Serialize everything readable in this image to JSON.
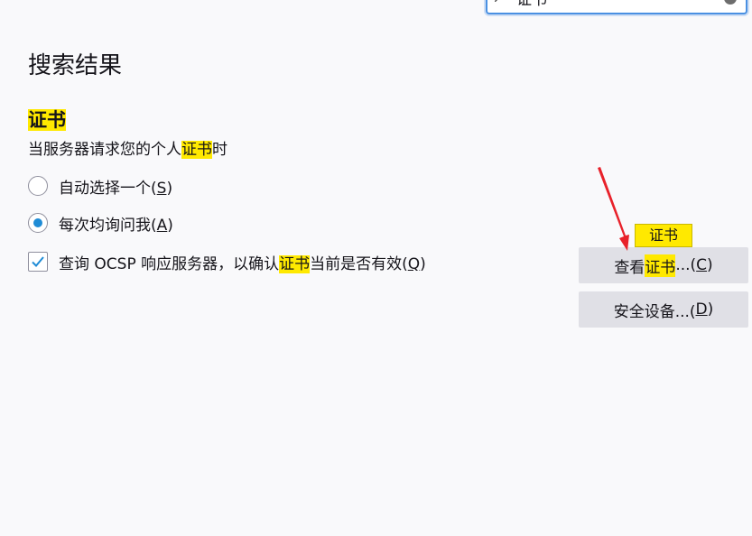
{
  "search": {
    "query": "证书"
  },
  "page": {
    "title": "搜索结果"
  },
  "certificates": {
    "section_title": "证书",
    "description_before": "当服务器请求您的个人",
    "description_highlight": "证书",
    "description_after": "时",
    "options": [
      {
        "label": "自动选择一个(",
        "accesskey": "S",
        "suffix": ")",
        "selected": false
      },
      {
        "label": "每次均询问我(",
        "accesskey": "A",
        "suffix": ")",
        "selected": true
      }
    ],
    "ocsp": {
      "before": "查询 OCSP 响应服务器，以确认",
      "highlight": "证书",
      "after": "当前是否有效(",
      "accesskey": "Q",
      "suffix": ")",
      "checked": true
    },
    "view_button": {
      "before": "查看",
      "highlight": "证书",
      "after": "...(",
      "accesskey": "C",
      "suffix": ")"
    },
    "security_devices_button": {
      "label": "安全设备...(",
      "accesskey": "D",
      "suffix": ")"
    },
    "tooltip": "证书"
  },
  "colors": {
    "highlight": "#ffe900",
    "accent": "#1f8cd6",
    "annotation_arrow": "#e8212a",
    "button_bg": "#e0e0e6"
  }
}
